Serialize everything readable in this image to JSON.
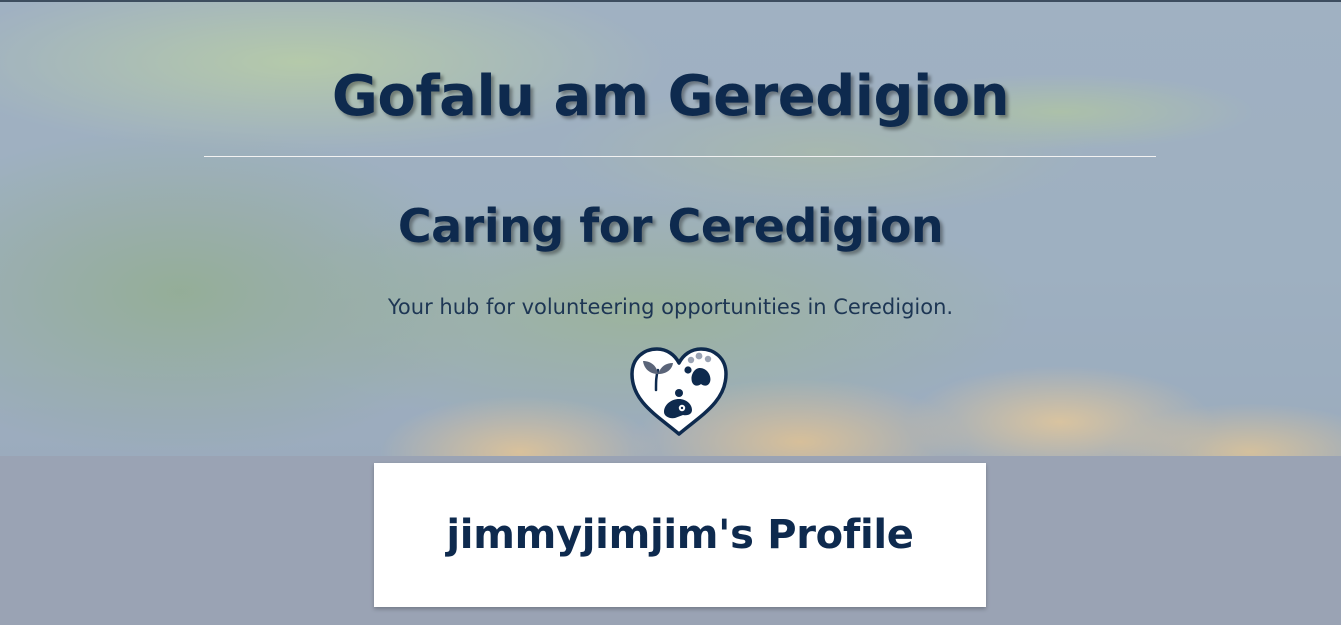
{
  "hero": {
    "title_welsh": "Gofalu am Geredigion",
    "title_english": "Caring for Ceredigion",
    "tagline": "Your hub for volunteering opportunities in Ceredigion.",
    "logo_icon": "heart-icon"
  },
  "profile": {
    "heading": "jimmyjimjim's Profile"
  },
  "colors": {
    "primary_text": "#0e2a4e",
    "page_background": "#9aa3b4",
    "card_background": "#ffffff"
  }
}
